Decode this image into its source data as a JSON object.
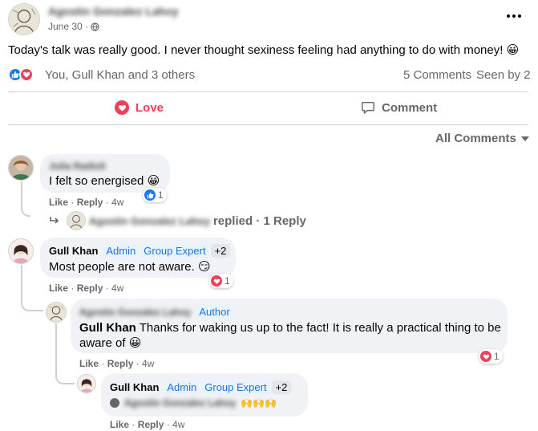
{
  "post": {
    "author_name": "Agostin Gonzalez Lahoy",
    "date": "June 30",
    "privacy_icon": "globe-icon",
    "text": "Today's talk was really good. I never thought sexiness feeling had anything to do with money!",
    "emoji": "😀",
    "more_icon": "more-dots-icon"
  },
  "reactions": {
    "summary": "You, Gull Khan and 3 others",
    "comments_count": "5 Comments",
    "seen_by": "Seen by 2"
  },
  "actions": {
    "love_label": "Love",
    "comment_label": "Comment"
  },
  "comments_filter": {
    "label": "All Comments"
  },
  "comments": [
    {
      "author": "Julia Radioli",
      "text": "I felt so energised",
      "reaction_count": "1",
      "like": "Like",
      "reply": "Reply",
      "time": "4w",
      "replies_summary": {
        "author": "Agostin Gonzalez Lahoy",
        "text": "replied · 1 Reply"
      }
    },
    {
      "author": "Gull Khan",
      "badges": [
        "Admin",
        "Group Expert",
        "+2"
      ],
      "text": "Most people are not aware.",
      "reaction_count": "1",
      "like": "Like",
      "reply": "Reply",
      "time": "4w"
    }
  ],
  "replies": [
    {
      "author": "Agostin Gonzalez Lahoy",
      "badge": "Author",
      "mention": "Gull Khan",
      "text": "Thanks for waking us up to the fact! It is really a practical thing to be aware of",
      "reaction_count": "1",
      "like": "Like",
      "reply": "Reply",
      "time": "4w"
    },
    {
      "author": "Gull Khan",
      "badges": [
        "Admin",
        "Group Expert",
        "+2"
      ],
      "mention": "Agostin Gonzalez Lahoy",
      "emojis": "🙌🙌🙌",
      "like": "Like",
      "reply": "Reply",
      "time": "4w"
    }
  ]
}
